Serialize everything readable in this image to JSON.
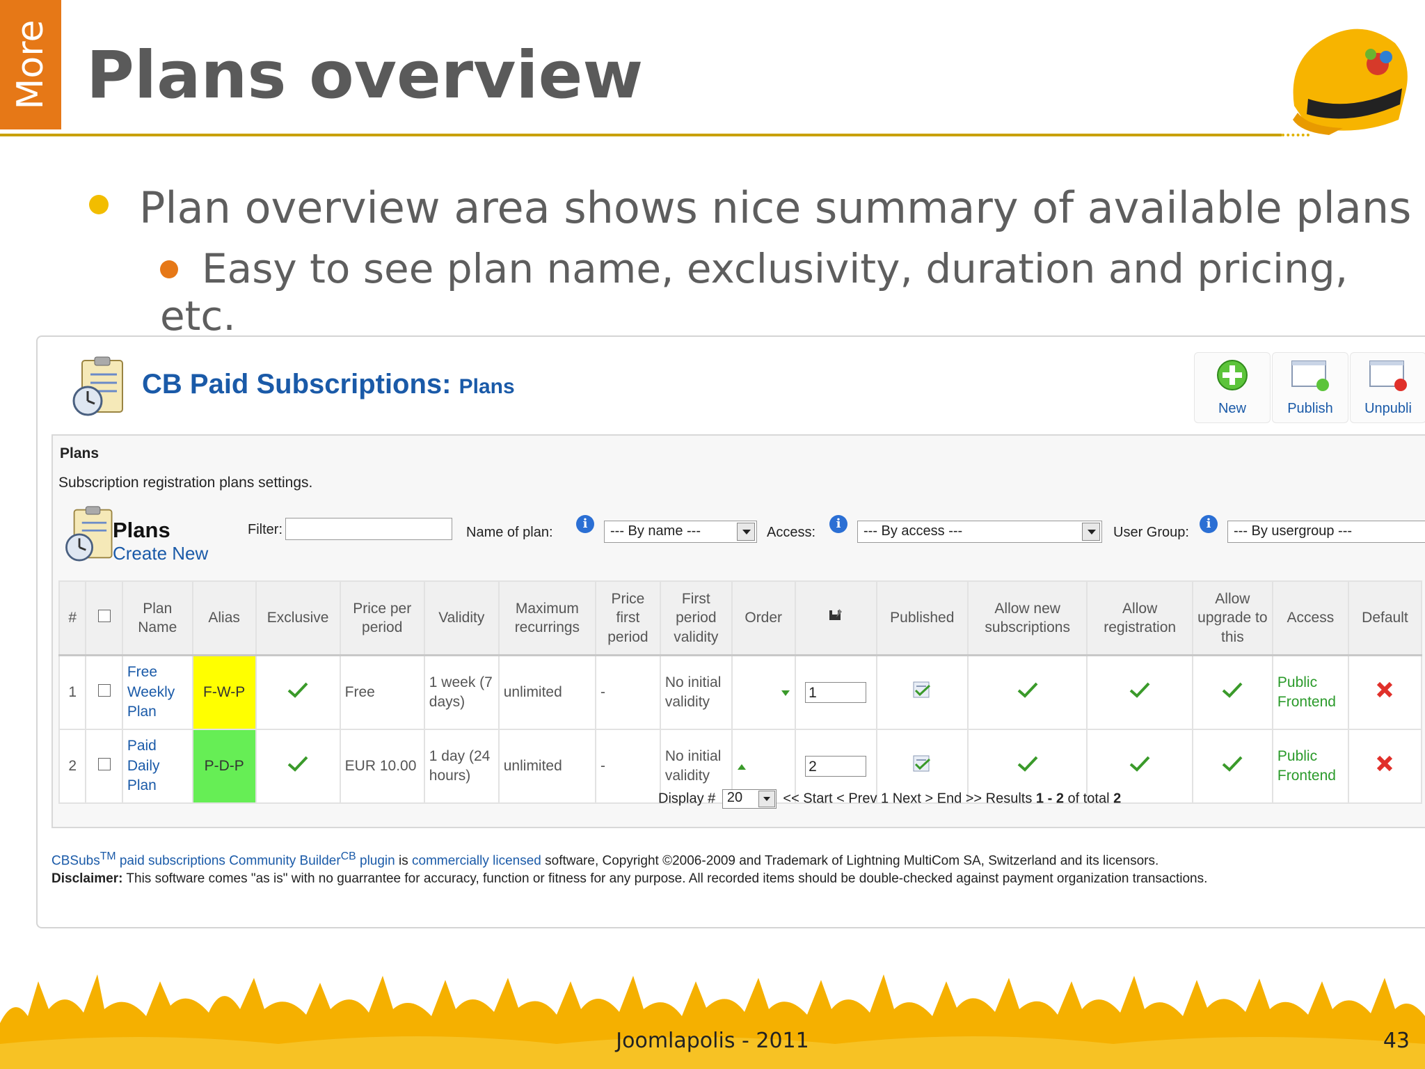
{
  "slide": {
    "side_tab": "More",
    "title": "Plans overview",
    "bullets": [
      "Plan overview area shows nice summary of available plans",
      "Easy to see plan name, exclusivity, duration and pricing, etc."
    ],
    "footer": "Joomlapolis - 2011",
    "page_number": "43",
    "colors": {
      "accent_orange": "#e67817",
      "accent_yellow": "#f2bd00",
      "rule": "#c9a100"
    }
  },
  "app": {
    "title_main": "CB Paid Subscriptions:",
    "title_sub": "Plans",
    "toolbar": {
      "new_label": "New",
      "publish_label": "Publish",
      "unpublish_label": "Unpubli"
    },
    "panel": {
      "heading": "Plans",
      "description": "Subscription registration plans settings.",
      "plans_title": "Plans",
      "create_new": "Create New"
    },
    "filters": {
      "filter_label": "Filter:",
      "filter_value": "",
      "name_label": "Name of plan:",
      "name_select": "--- By name ---",
      "access_label": "Access:",
      "access_select": "--- By access ---",
      "usergroup_label": "User Group:",
      "usergroup_select": "--- By usergroup ---",
      "info_glyph": "i"
    },
    "table": {
      "headers": [
        "#",
        "",
        "Plan Name",
        "Alias",
        "Exclusive",
        "Price per period",
        "Validity",
        "Maximum recurrings",
        "Price first period",
        "First period validity",
        "Order",
        "",
        "Published",
        "Allow new subscriptions",
        "Allow registration",
        "Allow upgrade to this",
        "Access",
        "Default"
      ],
      "rows": [
        {
          "num": "1",
          "name": "Free Weekly Plan",
          "alias": "F-W-P",
          "alias_color": "#ffff00",
          "price": "Free",
          "validity": "1 week (7 days)",
          "max_recurrings": "unlimited",
          "price_first": "-",
          "first_validity": "No initial validity",
          "order_value": "1",
          "access": "Public Frontend"
        },
        {
          "num": "2",
          "name": "Paid Daily Plan",
          "alias": "P-D-P",
          "alias_color": "#66ee55",
          "price": "EUR 10.00",
          "validity": "1 day (24 hours)",
          "max_recurrings": "unlimited",
          "price_first": "-",
          "first_validity": "No initial validity",
          "order_value": "2",
          "access": "Public Frontend"
        }
      ]
    },
    "pager": {
      "display_label": "Display #",
      "display_value": "20",
      "nav": "<< Start < Prev 1 Next > End >> Results",
      "range": "1 - 2",
      "of_total": "of total",
      "total": "2"
    },
    "footer": {
      "line1_a": "CBSubs",
      "tm": "TM",
      "line1_b": "paid subscriptions Community Builder",
      "cb": "CB",
      "line1_c": "plugin",
      "line1_d": "is",
      "line1_e": "commercially licensed",
      "line1_f": "software, Copyright ©2006-2009 and Trademark of Lightning MultiCom SA, Switzerland and its licensors.",
      "disclaimer_label": "Disclaimer:",
      "disclaimer_text": "This software comes \"as is\" with no guarrantee for accuracy, function or fitness for any purpose. All recorded items should be double-checked against payment organization transactions."
    }
  }
}
